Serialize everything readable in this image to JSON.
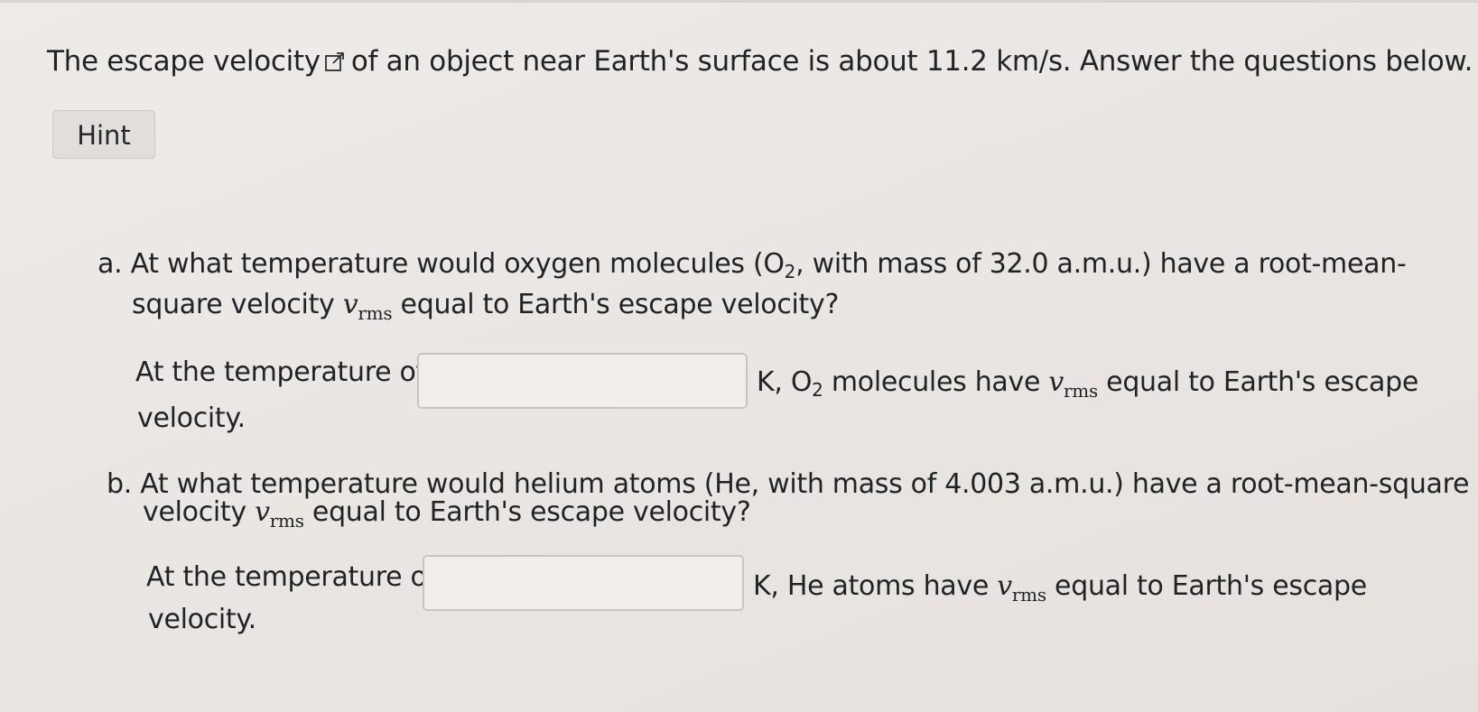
{
  "intro": {
    "before_link": "The escape velocity",
    "after_link": "of an object near Earth's surface is about 11.2 km/s. Answer the questions below."
  },
  "hint_label": "Hint",
  "part_a": {
    "marker": "a.",
    "line1_pre": "At what temperature would oxygen molecules (O",
    "line1_sub": "2",
    "line1_post": ", with mass of 32.0 a.m.u.) have a root-mean-",
    "line2_pre": "square velocity",
    "var_main": "v",
    "var_sub": "rms",
    "line2_post": "equal to Earth's escape velocity?",
    "answer_pre": "At the temperature of",
    "answer_post_pre": "K, O",
    "answer_post_sub": "2",
    "answer_post_mid": "molecules have",
    "answer_post_end": "equal to Earth's escape",
    "answer_line2": "velocity.",
    "input_value": ""
  },
  "part_b": {
    "marker": "b.",
    "line1": "At what temperature would helium atoms (He, with mass of 4.003 a.m.u.) have a root-mean-square",
    "line2_pre": "velocity",
    "var_main": "v",
    "var_sub": "rms",
    "line2_post": "equal to Earth's escape velocity?",
    "answer_pre": "At the temperature of",
    "answer_post_pre": "K, He atoms have",
    "answer_post_end": "equal to Earth's escape",
    "answer_line2": "velocity.",
    "input_value": ""
  },
  "icons": {
    "external_link": "external-link-icon"
  }
}
